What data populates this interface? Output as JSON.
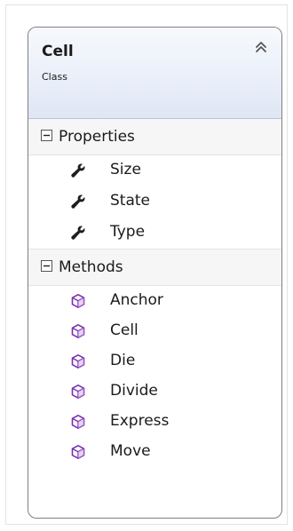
{
  "class": {
    "name": "Cell",
    "stereotype": "Class",
    "collapse_icon": "double-chevron-up-icon"
  },
  "properties": {
    "title": "Properties",
    "toggle_icon": "minus-square-icon",
    "member_icon": "wrench-icon",
    "items": [
      "Size",
      "State",
      "Type"
    ]
  },
  "methods": {
    "title": "Methods",
    "toggle_icon": "minus-square-icon",
    "member_icon": "method-cube-icon",
    "items": [
      "Anchor",
      "Cell",
      "Die",
      "Divide",
      "Express",
      "Move"
    ]
  },
  "colors": {
    "header_gradient_top": "#f7f9fd",
    "header_gradient_bottom": "#dfe6f4",
    "method_icon": "#7b2fb0",
    "wrench_icon": "#1e1e1e",
    "border": "#7f7f7f"
  }
}
